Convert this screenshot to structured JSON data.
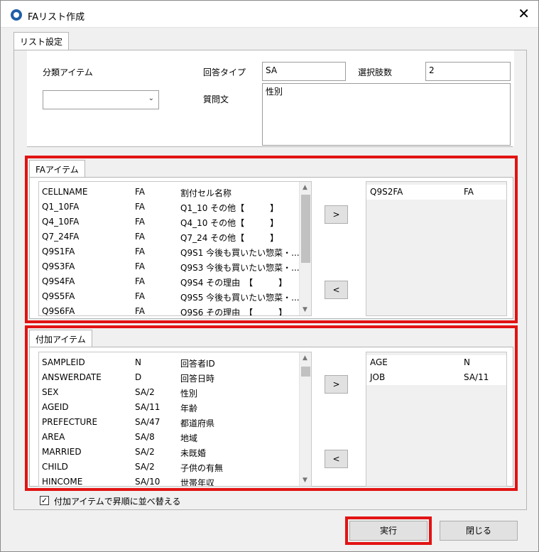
{
  "window": {
    "title": "FAリスト作成",
    "close_glyph": "✕"
  },
  "tabs": {
    "main": "リスト設定",
    "fa_items": "FAアイテム",
    "extra_items": "付加アイテム"
  },
  "settings": {
    "category_label": "分類アイテム",
    "category_value": "",
    "answer_type_label": "回答タイプ",
    "answer_type_value": "SA",
    "choices_label": "選択肢数",
    "choices_value": "2",
    "question_label": "質問文",
    "question_value": "性別"
  },
  "fa_list": [
    [
      "CELLNAME",
      "FA",
      "割付セル名称"
    ],
    [
      "Q1_10FA",
      "FA",
      "Q1_10 その他【　　　】"
    ],
    [
      "Q4_10FA",
      "FA",
      "Q4_10 その他【　　　】"
    ],
    [
      "Q7_24FA",
      "FA",
      "Q7_24 その他【　　　】"
    ],
    [
      "Q9S1FA",
      "FA",
      "Q9S1 今後も買いたい惣菜・..."
    ],
    [
      "Q9S3FA",
      "FA",
      "Q9S3 今後も買いたい惣菜・..."
    ],
    [
      "Q9S4FA",
      "FA",
      "Q9S4 その理由　【　　　】"
    ],
    [
      "Q9S5FA",
      "FA",
      "Q9S5 今後も買いたい惣菜・..."
    ],
    [
      "Q9S6FA",
      "FA",
      "Q9S6 その理由　【　　　】"
    ]
  ],
  "fa_selected": [
    [
      "Q9S2FA",
      "FA"
    ]
  ],
  "extra_list": [
    [
      "SAMPLEID",
      "N",
      "回答者ID"
    ],
    [
      "ANSWERDATE",
      "D",
      "回答日時"
    ],
    [
      "SEX",
      "SA/2",
      "性別"
    ],
    [
      "AGEID",
      "SA/11",
      "年齢"
    ],
    [
      "PREFECTURE",
      "SA/47",
      "都道府県"
    ],
    [
      "AREA",
      "SA/8",
      "地域"
    ],
    [
      "MARRIED",
      "SA/2",
      "未既婚"
    ],
    [
      "CHILD",
      "SA/2",
      "子供の有無"
    ],
    [
      "HINCOME",
      "SA/10",
      "世帯年収"
    ]
  ],
  "extra_selected": [
    [
      "AGE",
      "N"
    ],
    [
      "JOB",
      "SA/11"
    ]
  ],
  "buttons": {
    "add": ">",
    "remove": "<",
    "run": "実行",
    "close": "閉じる"
  },
  "sort_checkbox": {
    "label": "付加アイテムで昇順に並べ替える",
    "check_glyph": "✓"
  },
  "colors": {
    "highlight": "#e21313",
    "app_icon": "#1f5fa8"
  }
}
